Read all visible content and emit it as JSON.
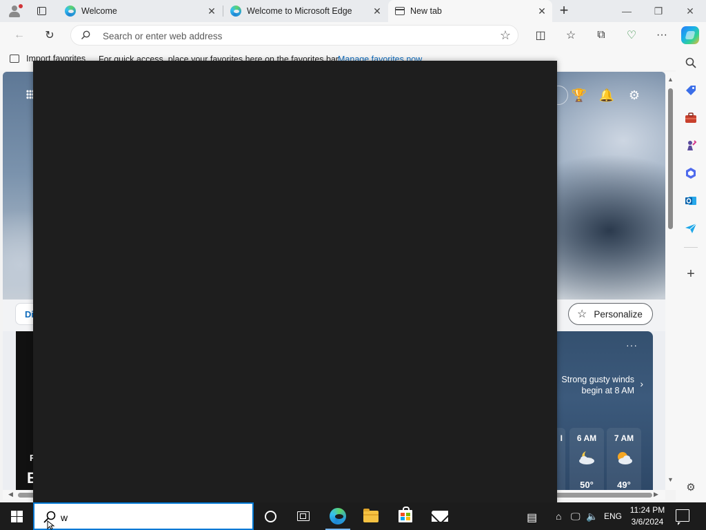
{
  "browser": {
    "tabs": [
      {
        "title": "Welcome"
      },
      {
        "title": "Welcome to Microsoft Edge"
      },
      {
        "title": "New tab"
      }
    ],
    "address_placeholder": "Search or enter web address",
    "favorites_bar": {
      "import_label": "Import favorites",
      "message": "For quick access, place your favorites here on the favorites bar.",
      "manage_link": "Manage favorites now"
    }
  },
  "newtab": {
    "filter_partial": "Di",
    "personalize_label": "Personalize",
    "feed_partial": {
      "line1": "F",
      "line2": "E"
    },
    "weather": {
      "alert": "Strong gusty winds begin at 8 AM",
      "hours": [
        {
          "time": "I",
          "temp": ""
        },
        {
          "time": "6 AM",
          "temp": "50°",
          "icon": "partly-cloudy-night-icon"
        },
        {
          "time": "7 AM",
          "temp": "49°",
          "icon": "partly-sunny-icon"
        }
      ]
    }
  },
  "taskbar": {
    "search_value": "w",
    "language": "ENG",
    "time": "11:24 PM",
    "date": "3/6/2024"
  },
  "colors": {
    "accent": "#0078d4",
    "taskbar_bg": "#1c1c1c",
    "start_panel_bg": "#1e1e1e"
  }
}
